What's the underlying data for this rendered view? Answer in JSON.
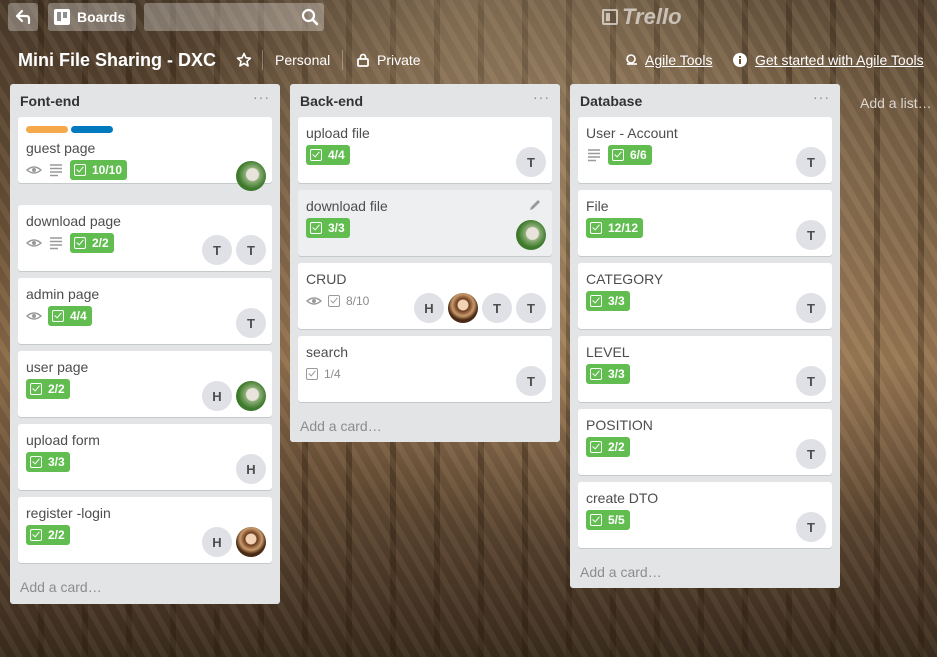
{
  "header": {
    "boards_label": "Boards",
    "search_placeholder": "",
    "logo_text": "Trello"
  },
  "board": {
    "title": "Mini File Sharing - DXC",
    "team": "Personal",
    "visibility": "Private",
    "agile_tools": "Agile Tools",
    "get_started": "Get started with Agile Tools"
  },
  "lists": [
    {
      "title": "Font-end",
      "menu": "···",
      "add_card": "Add a card…",
      "cards": [
        {
          "title": "guest page",
          "labels": [
            "#f6a94a",
            "#0079bf"
          ],
          "checklist": "10/10",
          "avatars": [
            "photo"
          ]
        },
        {
          "title": "download page",
          "checklist": "2/2",
          "avatars": [
            "T",
            "T"
          ]
        },
        {
          "title": "admin page",
          "checklist": "4/4",
          "avatars": [
            "T"
          ]
        },
        {
          "title": "user page",
          "checklist": "2/2",
          "avatars": [
            "H",
            "photo"
          ]
        },
        {
          "title": "upload form",
          "checklist": "3/3",
          "avatars": [
            "H"
          ]
        },
        {
          "title": "register -login",
          "checklist": "2/2",
          "avatars": [
            "H",
            "photo2"
          ]
        }
      ]
    },
    {
      "title": "Back-end",
      "menu": "···",
      "add_card": "Add a card…",
      "cards": [
        {
          "title": "upload file",
          "checklist": "4/4",
          "avatars": [
            "T"
          ]
        },
        {
          "title": "download file",
          "checklist": "3/3",
          "avatars": [
            "photo"
          ]
        },
        {
          "title": "CRUD",
          "checklist": "8/10",
          "avatars": [
            "H",
            "photo2",
            "T",
            "T"
          ]
        },
        {
          "title": "search",
          "checklist": "1/4",
          "avatars": [
            "T"
          ]
        }
      ]
    },
    {
      "title": "Database",
      "menu": "···",
      "add_card": "Add a card…",
      "cards": [
        {
          "title": "User - Account",
          "checklist": "6/6",
          "avatars": [
            "T"
          ]
        },
        {
          "title": "File",
          "checklist": "12/12",
          "avatars": [
            "T"
          ]
        },
        {
          "title": "CATEGORY",
          "checklist": "3/3",
          "avatars": [
            "T"
          ]
        },
        {
          "title": "LEVEL",
          "checklist": "3/3",
          "avatars": [
            "T"
          ]
        },
        {
          "title": "POSITION",
          "checklist": "2/2",
          "avatars": [
            "T"
          ]
        },
        {
          "title": "create DTO",
          "checklist": "5/5",
          "avatars": [
            "T"
          ]
        }
      ]
    }
  ],
  "add_list": "Add a list…",
  "colors": {
    "checklist_complete": "#61bd4f",
    "list_bg": "#e2e4e6",
    "label_orange": "#f6a94a",
    "label_blue": "#0079bf"
  }
}
